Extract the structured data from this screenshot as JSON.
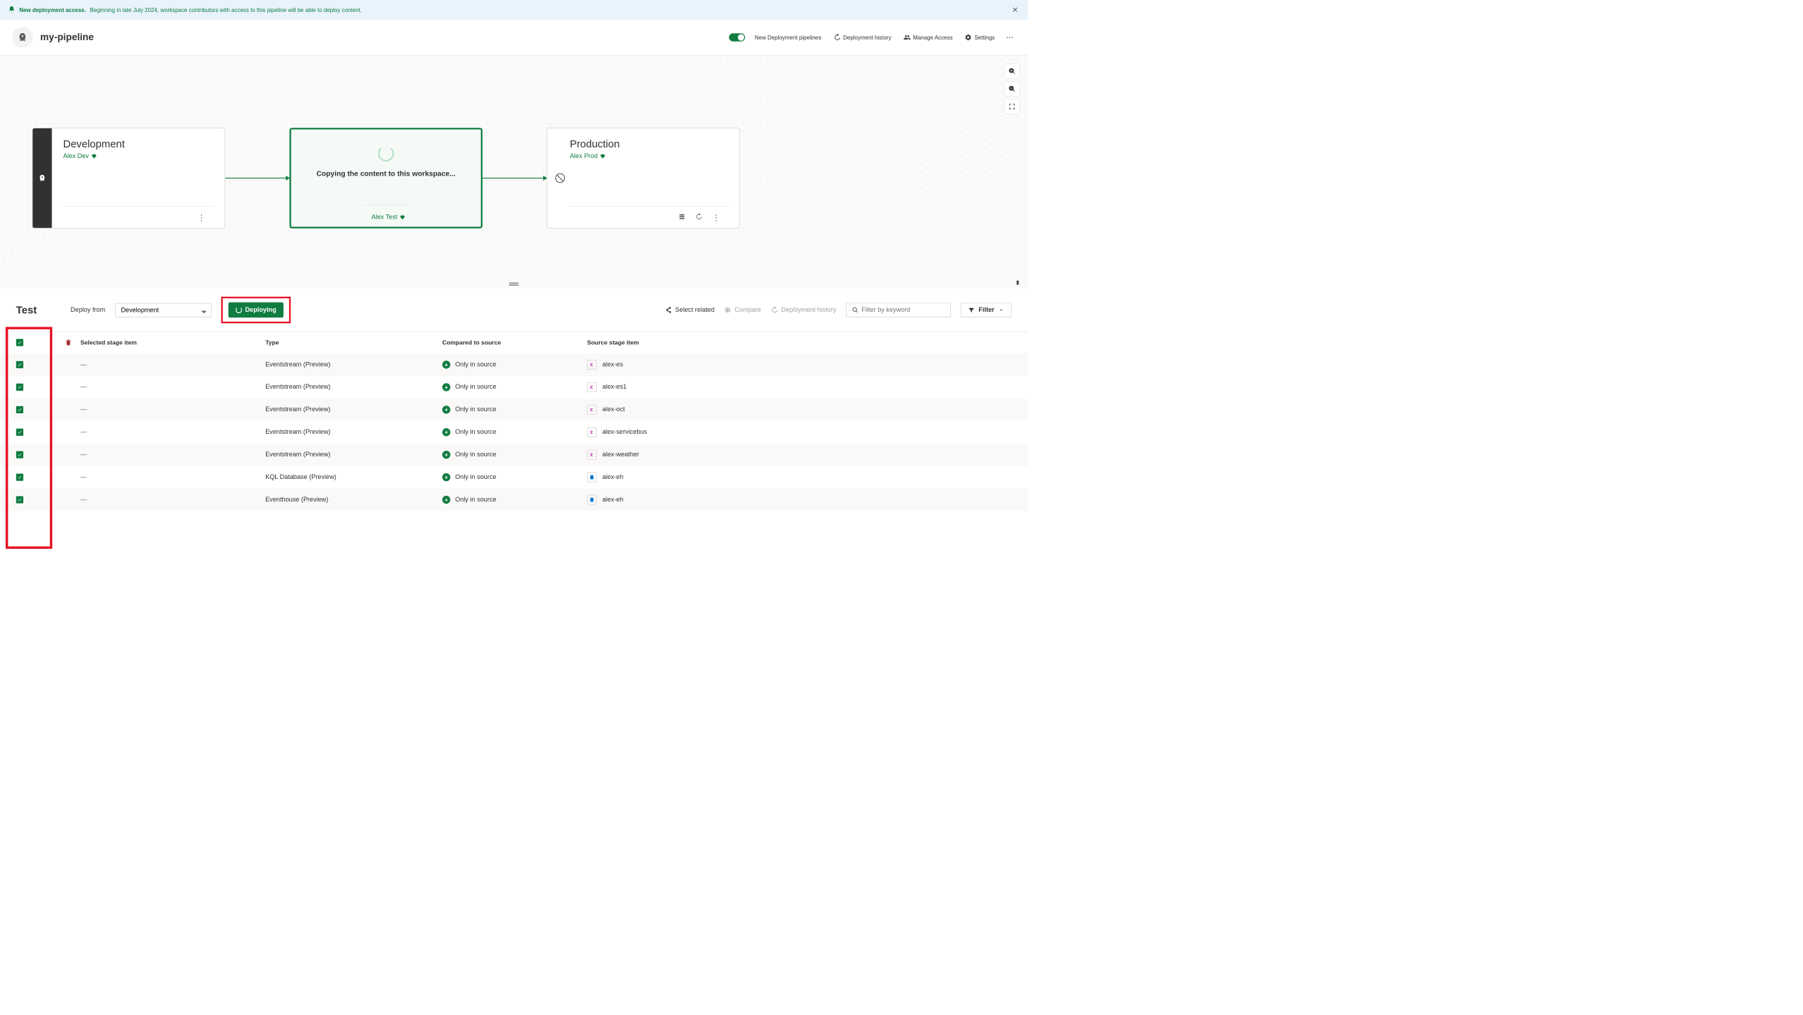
{
  "banner": {
    "title": "New deployment access.",
    "message": "Beginning in late July 2024, workspace contributors with access to this pipeline will be able to deploy content."
  },
  "header": {
    "pipeline_name": "my-pipeline",
    "nav": {
      "new_pipelines": "New Deployment pipelines",
      "history": "Deployment history",
      "access": "Manage Access",
      "settings": "Settings"
    }
  },
  "stages": {
    "dev": {
      "name": "Development",
      "workspace": "Alex Dev"
    },
    "test": {
      "copying": "Copying the content to this workspace...",
      "workspace": "Alex Test"
    },
    "prod": {
      "name": "Production",
      "workspace": "Alex Prod"
    }
  },
  "detail": {
    "stage": "Test",
    "deploy_from_label": "Deploy from",
    "deploy_from_value": "Development",
    "deploy_button": "Deploying",
    "select_related": "Select related",
    "compare": "Compare",
    "history": "Deployment history",
    "search_placeholder": "Filter by keyword",
    "filter": "Filter"
  },
  "table": {
    "col_selected": "Selected stage item",
    "col_type": "Type",
    "col_compared": "Compared to source",
    "col_source": "Source stage item",
    "rows": [
      {
        "type": "Eventstream (Preview)",
        "compare": "Only in source",
        "src": "alex-es",
        "icon": "pink"
      },
      {
        "type": "Eventstream (Preview)",
        "compare": "Only in source",
        "src": "alex-es1",
        "icon": "pink"
      },
      {
        "type": "Eventstream (Preview)",
        "compare": "Only in source",
        "src": "alex-oct",
        "icon": "pink"
      },
      {
        "type": "Eventstream (Preview)",
        "compare": "Only in source",
        "src": "alex-servicebus",
        "icon": "pink"
      },
      {
        "type": "Eventstream (Preview)",
        "compare": "Only in source",
        "src": "alex-weather",
        "icon": "pink"
      },
      {
        "type": "KQL Database (Preview)",
        "compare": "Only in source",
        "src": "alex-eh",
        "icon": "blue"
      },
      {
        "type": "Eventhouse (Preview)",
        "compare": "Only in source",
        "src": "alex-eh",
        "icon": "blue"
      }
    ]
  }
}
